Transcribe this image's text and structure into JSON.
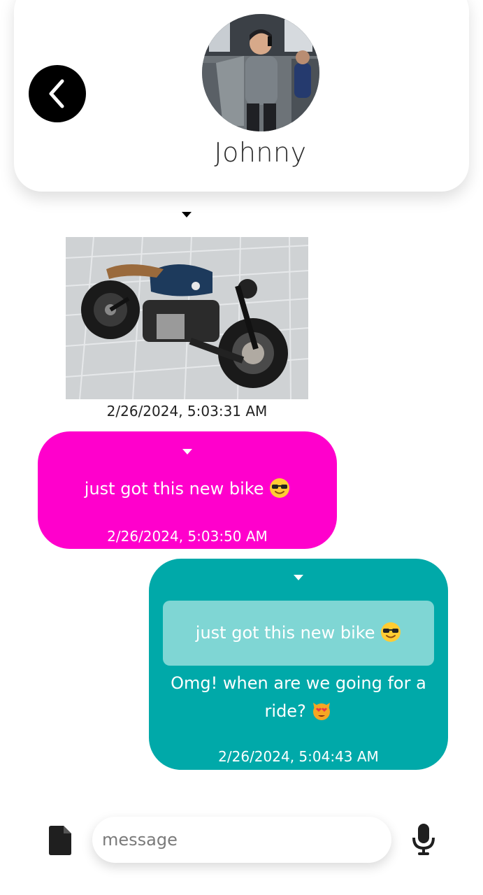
{
  "header": {
    "contact_name": "Johnny"
  },
  "messages": [
    {
      "type": "image",
      "image_description": "motorcycle",
      "timestamp": "2/26/2024, 5:03:31 AM"
    },
    {
      "type": "text",
      "text": "just got this new bike",
      "timestamp": "2/26/2024, 5:03:50 AM"
    },
    {
      "type": "reply",
      "quoted_text": "just got this new bike",
      "text": "Omg! when are we going for a ride?",
      "timestamp": "2/26/2024, 5:04:43 AM"
    }
  ],
  "composer": {
    "placeholder": "message",
    "value": ""
  },
  "icons": {
    "back": "chevron-left-icon",
    "attach": "file-icon",
    "mic": "microphone-icon",
    "dropdown": "caret-down-icon"
  },
  "colors": {
    "pink_bubble": "#ff00cc",
    "teal_bubble": "#00a9a9",
    "quote_box": "#7fd6d4"
  }
}
